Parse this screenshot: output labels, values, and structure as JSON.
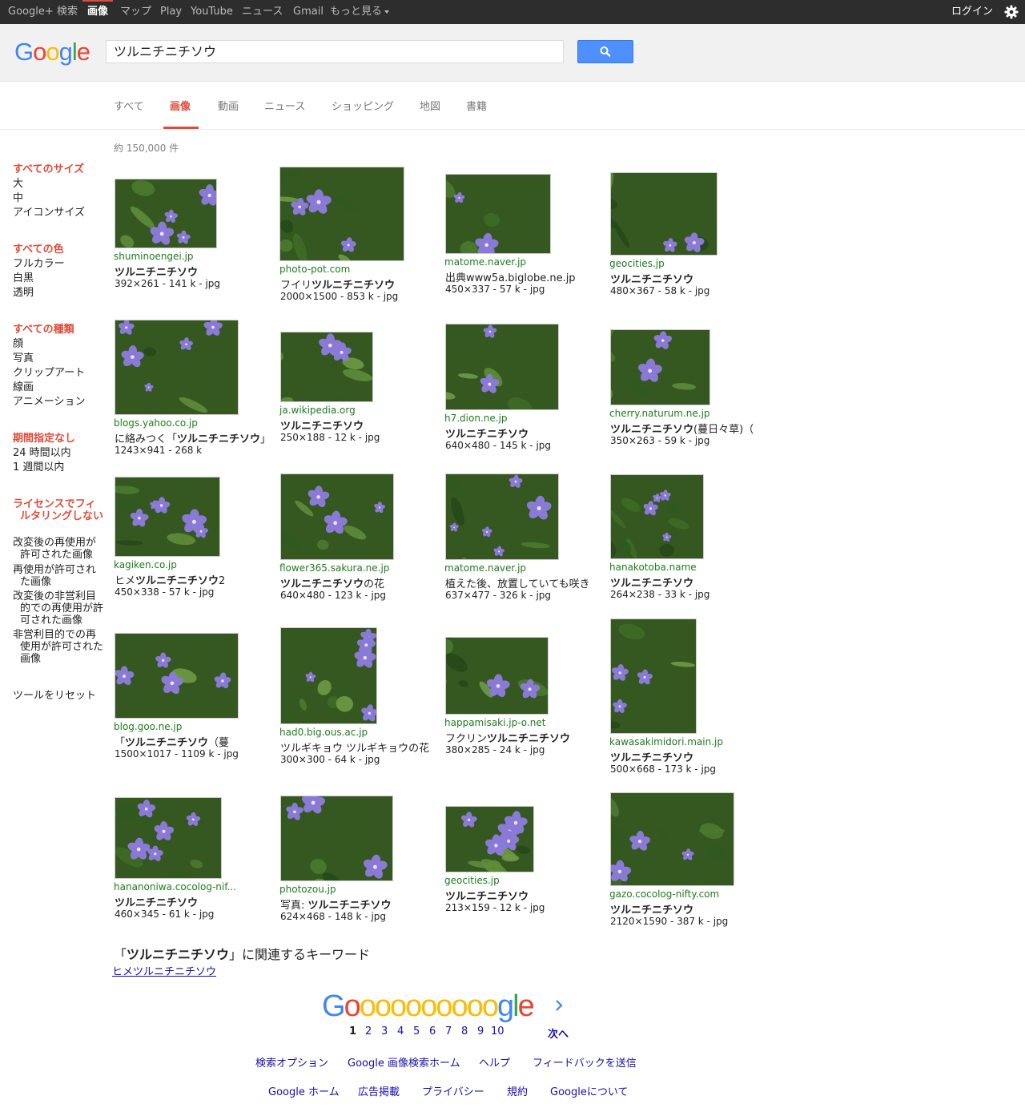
{
  "topbar": {
    "items": [
      "Google+",
      "検索",
      "画像",
      "マップ",
      "Play",
      "YouTube",
      "ニュース",
      "Gmail",
      "もっと見る"
    ],
    "login": "ログイン"
  },
  "search": {
    "query": "ツルニチニチソウ",
    "logo": "Google"
  },
  "tabs": [
    "すべて",
    "画像",
    "動画",
    "ニュース",
    "ショッピング",
    "地図",
    "書籍"
  ],
  "stats": "約 150,000 件",
  "sidebar": {
    "size": {
      "header": "すべてのサイズ",
      "items": [
        "大",
        "中",
        "アイコンサイズ"
      ]
    },
    "color": {
      "header": "すべての色",
      "items": [
        "フルカラー",
        "白黒",
        "透明"
      ]
    },
    "type": {
      "header": "すべての種類",
      "items": [
        "顔",
        "写真",
        "クリップアート",
        "線画",
        "アニメーション"
      ]
    },
    "time": {
      "header": "期間指定なし",
      "items": [
        "24 時間以内",
        "1 週間以内"
      ]
    },
    "license": {
      "header": "ライセンスでフィルタリングしない",
      "items": [
        "改変後の再使用が許可された画像",
        "再使用が許可された画像",
        "改変後の非営利目的での再使用が許可された画像",
        "非営利目的での再使用が許可された画像"
      ]
    },
    "reset": "ツールをリセット"
  },
  "results": [
    {
      "domain": "shuminoengei.jp",
      "title": "ツルニチニチソウ",
      "meta": "392×261 - 141 k - jpg"
    },
    {
      "domain": "photo-pot.com",
      "title": "フイリツルニチニチソウ",
      "meta": "2000×1500 - 853 k - jpg"
    },
    {
      "domain": "matome.naver.jp",
      "title": "出典www5a.biglobe.ne.jp",
      "meta": "450×337 - 57 k - jpg"
    },
    {
      "domain": "geocities.jp",
      "title": "ツルニチニチソウ",
      "meta": "480×367 - 58 k - jpg"
    },
    {
      "domain": "blogs.yahoo.co.jp",
      "title": "に絡みつく「ツルニチニチソウ」",
      "meta": "1243×941 - 268 k"
    },
    {
      "domain": "ja.wikipedia.org",
      "title": "ツルニチニチソウ",
      "meta": "250×188 - 12 k - jpg"
    },
    {
      "domain": "h7.dion.ne.jp",
      "title": "ツルニチニチソウ",
      "meta": "640×480 - 145 k - jpg"
    },
    {
      "domain": "cherry.naturum.ne.jp",
      "title": "ツルニチニチソウ(蔓日々草)（",
      "meta": "350×263 - 59 k - jpg"
    },
    {
      "domain": "kagiken.co.jp",
      "title": "ヒメツルニチニチソウ2",
      "meta": "450×338 - 57 k - jpg"
    },
    {
      "domain": "flower365.sakura.ne.jp",
      "title": "ツルニチニチソウの花",
      "meta": "640×480 - 123 k - jpg"
    },
    {
      "domain": "matome.naver.jp",
      "title": "植えた後、放置していても咲き",
      "meta": "637×477 - 326 k - jpg"
    },
    {
      "domain": "hanakotoba.name",
      "title": "ツルニチニチソウ",
      "meta": "264×238 - 33 k - jpg"
    },
    {
      "domain": "blog.goo.ne.jp",
      "title": "「ツルニチニチソウ（蔓",
      "meta": "1500×1017 - 1109 k - jpg"
    },
    {
      "domain": "had0.big.ous.ac.jp",
      "title": "ツルギキョウ ツルギキョウの花",
      "meta": "300×300 - 64 k - jpg"
    },
    {
      "domain": "happamisaki.jp-o.net",
      "title": "フクリンツルニチニチソウ",
      "meta": "380×285 - 24 k - jpg"
    },
    {
      "domain": "kawasakimidori.main.jp",
      "title": "ツルニチニチソウ",
      "meta": "500×668 - 173 k - jpg"
    },
    {
      "domain": "hananoniwa.cocolog-nif...",
      "title": "ツルニチニチソウ",
      "meta": "460×345 - 61 k - jpg"
    },
    {
      "domain": "photozou.jp",
      "title": "写真: ツルニチニチソウ",
      "meta": "624×468 - 148 k - jpg"
    },
    {
      "domain": "geocities.jp",
      "title": "ツルニチニチソウ",
      "meta": "213×159 - 12 k - jpg"
    },
    {
      "domain": "gazo.cocolog-nifty.com",
      "title": "ツルニチニチソウ",
      "meta": "2120×1590 - 387 k - jpg"
    }
  ],
  "related": {
    "heading": "「ツルニチニチソウ」に関連するキーワード",
    "link": "ヒメツルニチニチソウ"
  },
  "pagination": {
    "logo": "Goooooooooogle",
    "pages": [
      "1",
      "2",
      "3",
      "4",
      "5",
      "6",
      "7",
      "8",
      "9",
      "10"
    ],
    "next": "次へ"
  },
  "footer": {
    "row1": [
      "検索オプション",
      "Google 画像検索ホーム",
      "ヘルプ",
      "フィードバックを送信"
    ],
    "row2": [
      "Google ホーム",
      "広告掲載",
      "プライバシー",
      "規約",
      "Googleについて"
    ]
  },
  "colors": {
    "topbar": "#2d2d2d",
    "accent": "#dd4b39",
    "link": "#1a0dab",
    "domain": "#1e7c1e",
    "searchbtn": "#4d90fe"
  },
  "icons": [
    "search-icon",
    "gear-icon",
    "chevron-down-icon",
    "chevron-right-icon"
  ]
}
